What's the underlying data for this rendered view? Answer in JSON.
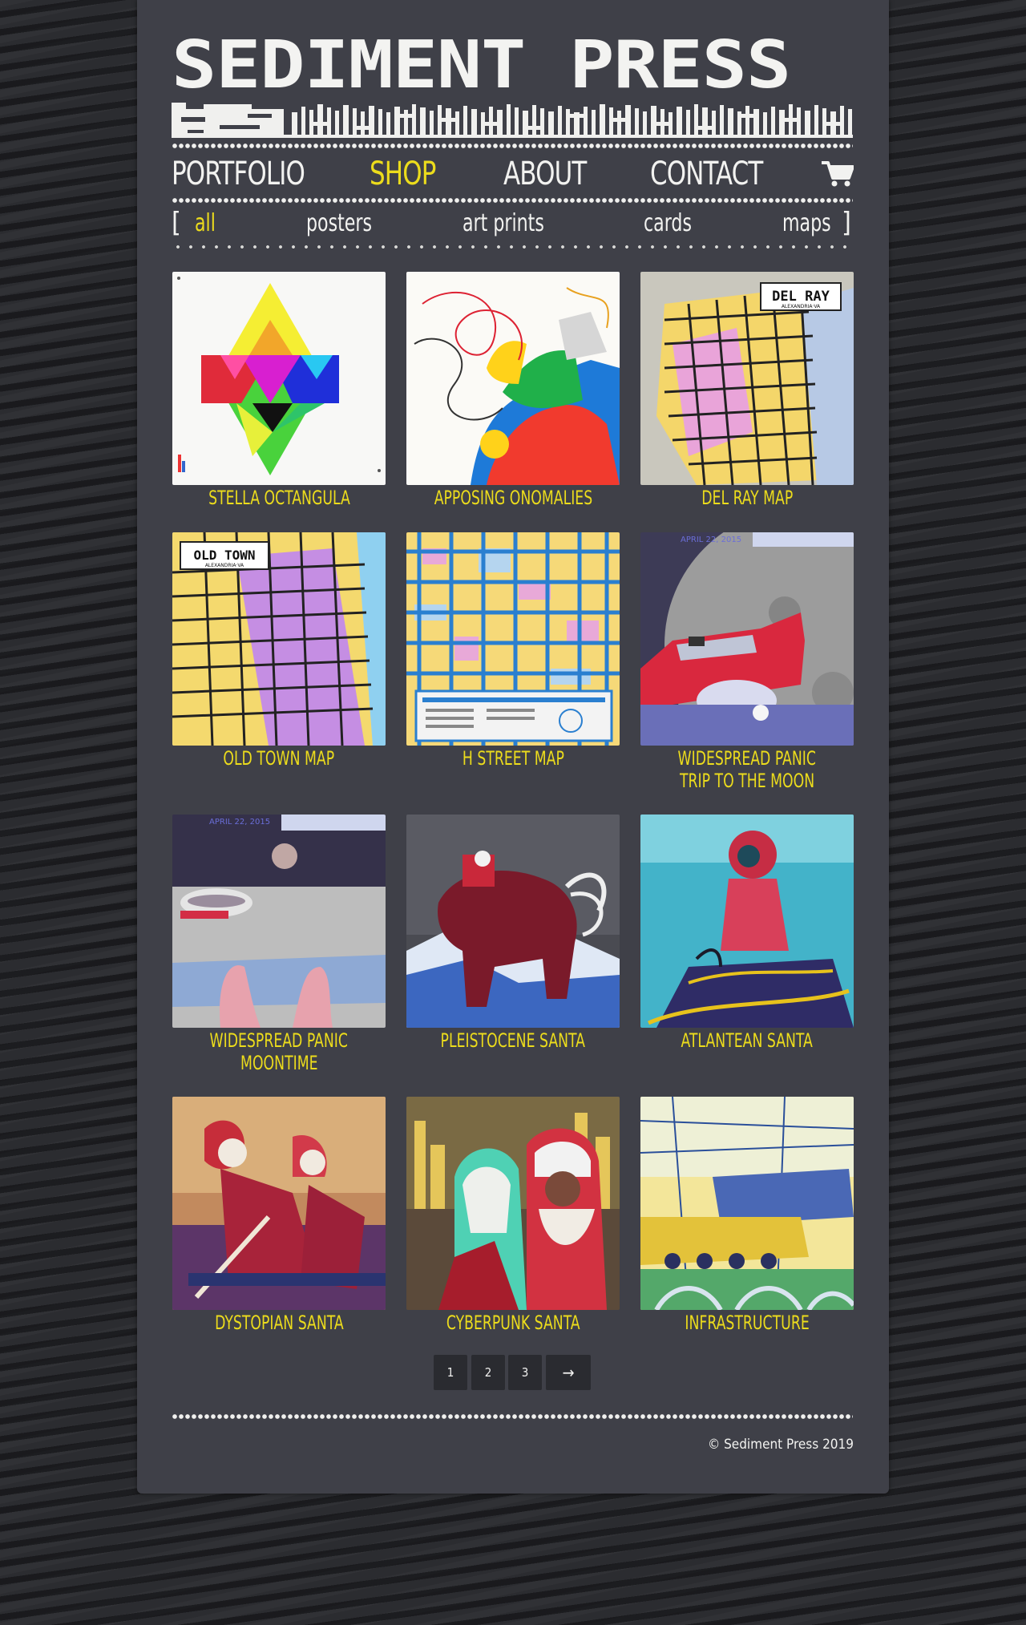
{
  "site": {
    "logo_text": "SEDIMENT PRESS"
  },
  "nav": {
    "items": [
      {
        "label": "PORTFOLIO",
        "active": false
      },
      {
        "label": "SHOP",
        "active": true
      },
      {
        "label": "ABOUT",
        "active": false
      },
      {
        "label": "CONTACT",
        "active": false
      }
    ],
    "cart_icon": "cart-icon"
  },
  "filter": {
    "open_bracket": "[",
    "close_bracket": "]",
    "items": [
      {
        "label": "all",
        "active": true
      },
      {
        "label": "posters",
        "active": false
      },
      {
        "label": "art prints",
        "active": false
      },
      {
        "label": "cards",
        "active": false
      },
      {
        "label": "maps",
        "active": false
      }
    ]
  },
  "products": [
    {
      "title": "STELLA OCTANGULA"
    },
    {
      "title": "APPOSING ONOMALIES"
    },
    {
      "title": "DEL RAY MAP",
      "badge": "DEL RAY",
      "badge_sub": "ALEXANDRIA·VA"
    },
    {
      "title": "OLD TOWN MAP",
      "badge": "OLD TOWN",
      "badge_sub": "ALEXANDRIA·VA"
    },
    {
      "title": "H STREET MAP"
    },
    {
      "title_line1": "WIDESPREAD PANIC",
      "title_line2": "TRIP TO THE MOON",
      "overlay": "APRIL 22, 2015"
    },
    {
      "title_line1": "WIDESPREAD PANIC",
      "title_line2": "MOONTIME",
      "overlay": "APRIL 22, 2015"
    },
    {
      "title": "PLEISTOCENE SANTA"
    },
    {
      "title": "ATLANTEAN SANTA"
    },
    {
      "title": "DYSTOPIAN SANTA"
    },
    {
      "title": "CYBERPUNK SANTA"
    },
    {
      "title": "INFRASTRUCTURE"
    }
  ],
  "pagination": {
    "pages": [
      "1",
      "2",
      "3"
    ],
    "current": "1",
    "next": "→"
  },
  "footer": {
    "copyright": "© Sediment Press 2019"
  },
  "colors": {
    "accent_yellow": "#ecdc1c",
    "panel": "#3f4048",
    "text_light": "#f2f2f0"
  }
}
